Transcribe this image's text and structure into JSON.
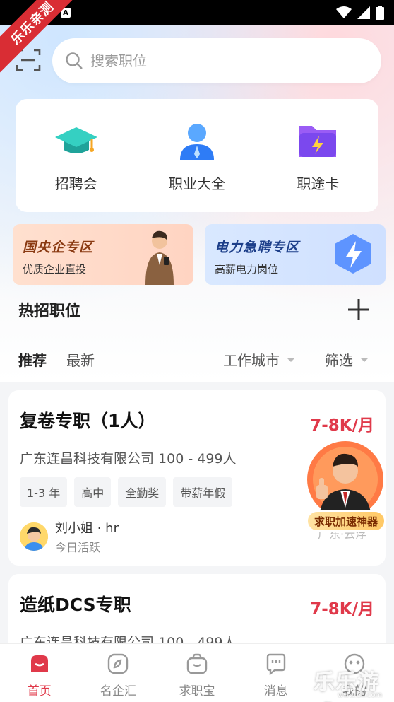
{
  "status_bar": {
    "notification_letter": "A"
  },
  "ribbon": {
    "text": "乐乐亲测"
  },
  "search": {
    "placeholder": "搜索职位"
  },
  "quick_entries": [
    {
      "label": "招聘会",
      "icon": "graduation-cap-icon"
    },
    {
      "label": "职业大全",
      "icon": "person-icon"
    },
    {
      "label": "职途卡",
      "icon": "lightning-folder-icon"
    }
  ],
  "promos": [
    {
      "title": "国央企专区",
      "subtitle": "优质企业直投"
    },
    {
      "title": "电力急聘专区",
      "subtitle": "高薪电力岗位"
    }
  ],
  "section": {
    "title": "热招职位"
  },
  "filters": {
    "tab_recommend": "推荐",
    "tab_latest": "最新",
    "city": "工作城市",
    "filter": "筛选"
  },
  "jobs": [
    {
      "title": "复卷专职（1人）",
      "salary": "7-8K/月",
      "company": "广东连昌科技有限公司 100 - 499人",
      "tags": [
        "1-3 年",
        "高中",
        "全勤奖",
        "带薪年假"
      ],
      "recruiter": "刘小姐 · hr",
      "activity": "今日活跃",
      "location_partial": "广东·云浮"
    },
    {
      "title": "造纸DCS专职",
      "salary": "7-8K/月",
      "company": "广东连昌科技有限公司 100 - 499人"
    }
  ],
  "float_badge": {
    "label": "求职加速神器"
  },
  "bottom_nav": [
    {
      "label": "首页",
      "icon": "home-icon",
      "active": true
    },
    {
      "label": "名企汇",
      "icon": "compass-icon",
      "active": false
    },
    {
      "label": "求职宝",
      "icon": "bag-icon",
      "active": false
    },
    {
      "label": "消息",
      "icon": "message-icon",
      "active": false
    },
    {
      "label": "我的",
      "icon": "profile-icon",
      "active": false
    }
  ],
  "watermark": {
    "text": "乐乐游戏",
    "url": "www.6ll.com"
  },
  "colors": {
    "accent": "#e0394a",
    "promo_left": "#ffd4c2",
    "promo_right": "#cfe0ff"
  }
}
